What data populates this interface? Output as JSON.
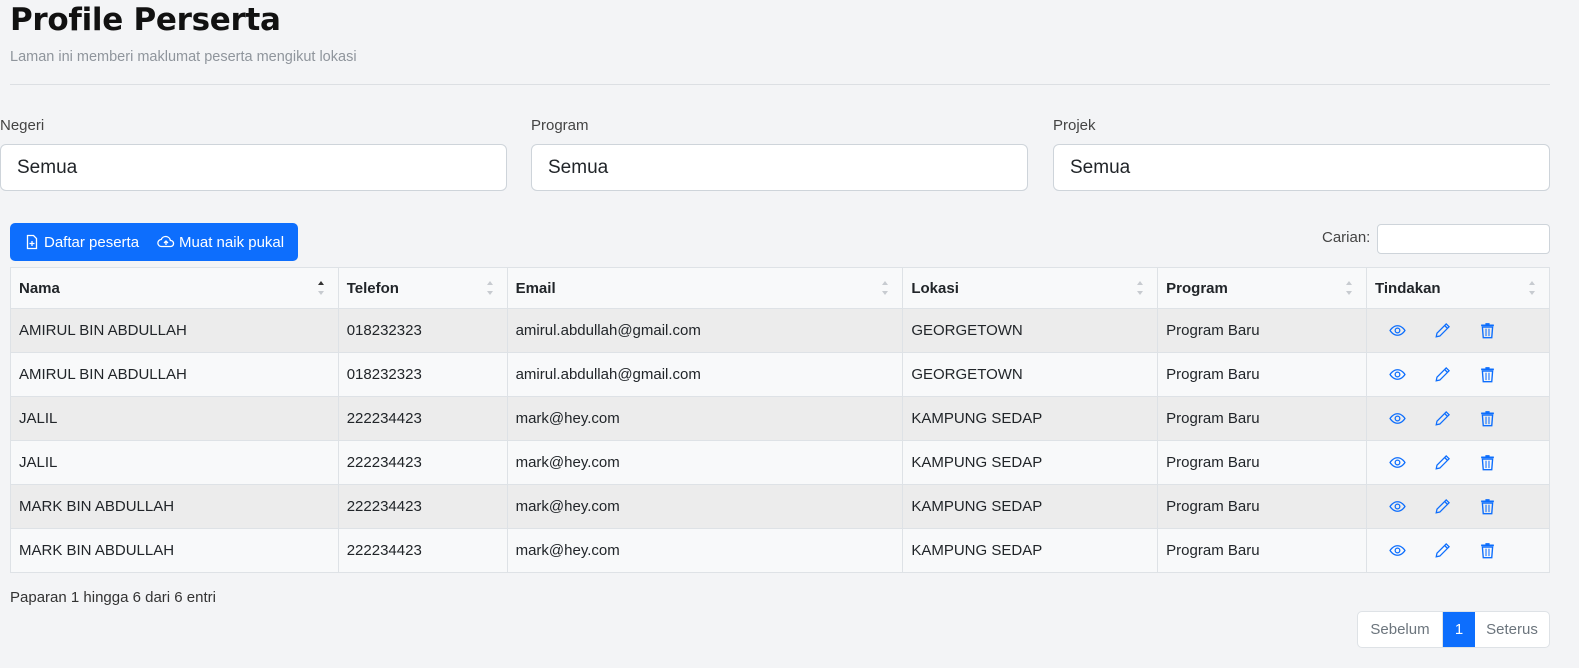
{
  "header": {
    "title": "Profile Perserta",
    "subtitle": "Laman ini memberi maklumat peserta mengikut lokasi"
  },
  "filters": [
    {
      "label": "Negeri",
      "value": "Semua"
    },
    {
      "label": "Program",
      "value": "Semua"
    },
    {
      "label": "Projek",
      "value": "Semua"
    }
  ],
  "toolbar": {
    "register_label": "Daftar peserta",
    "upload_label": "Muat naik pukal",
    "button_color": "#0d6efd"
  },
  "search": {
    "label": "Carian:",
    "value": ""
  },
  "table": {
    "columns": [
      "Nama",
      "Telefon",
      "Email",
      "Lokasi",
      "Program",
      "Tindakan"
    ],
    "sort_column": "Nama",
    "rows": [
      {
        "nama": "AMIRUL BIN ABDULLAH",
        "telefon": "018232323",
        "email": "amirul.abdullah@gmail.com",
        "lokasi": "GEORGETOWN",
        "program": "Program Baru"
      },
      {
        "nama": "AMIRUL BIN ABDULLAH",
        "telefon": "018232323",
        "email": "amirul.abdullah@gmail.com",
        "lokasi": "GEORGETOWN",
        "program": "Program Baru"
      },
      {
        "nama": "JALIL",
        "telefon": "222234423",
        "email": "mark@hey.com",
        "lokasi": "KAMPUNG SEDAP",
        "program": "Program Baru"
      },
      {
        "nama": "JALIL",
        "telefon": "222234423",
        "email": "mark@hey.com",
        "lokasi": "KAMPUNG SEDAP",
        "program": "Program Baru"
      },
      {
        "nama": "MARK BIN ABDULLAH",
        "telefon": "222234423",
        "email": "mark@hey.com",
        "lokasi": "KAMPUNG SEDAP",
        "program": "Program Baru"
      },
      {
        "nama": "MARK BIN ABDULLAH",
        "telefon": "222234423",
        "email": "mark@hey.com",
        "lokasi": "KAMPUNG SEDAP",
        "program": "Program Baru"
      }
    ],
    "action_icons": [
      "eye-icon",
      "pencil-icon",
      "trash-icon"
    ]
  },
  "footer": {
    "info": "Paparan 1 hingga 6 dari 6 entri",
    "prev_label": "Sebelum",
    "current_page": "1",
    "next_label": "Seterus"
  }
}
